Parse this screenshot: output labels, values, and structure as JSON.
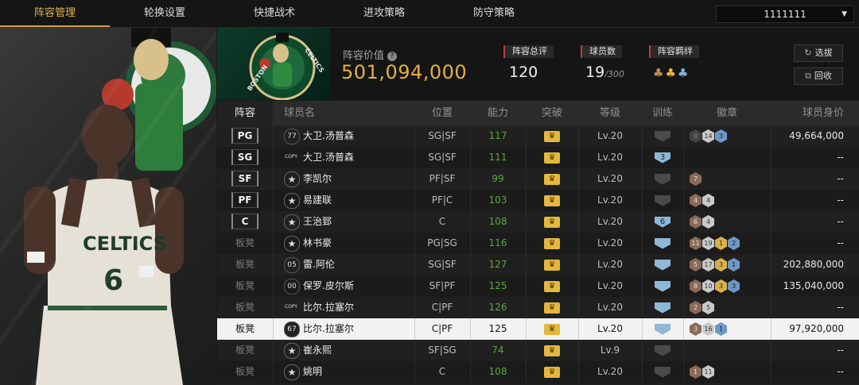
{
  "nav": {
    "tabs": [
      "阵容管理",
      "轮换设置",
      "快捷战术",
      "进攻策略",
      "防守策略"
    ],
    "active_index": 0,
    "account": "1111111"
  },
  "header": {
    "team_value_label": "阵容价值",
    "team_value": "501,094,000",
    "rating_label": "阵容总评",
    "rating": "120",
    "player_count_label": "球员数",
    "player_count": "19",
    "player_capacity": "/300",
    "bond_label": "阵容羁绊",
    "btn_select": "选拔",
    "btn_recycle": "回收"
  },
  "table": {
    "headers": [
      "阵容",
      "球员名",
      "位置",
      "能力",
      "突破",
      "等级",
      "训练",
      "徽章",
      "球员身价"
    ],
    "rows": [
      {
        "slot": "PG",
        "starter": true,
        "num": "77",
        "name": "大卫.汤普森",
        "pos": "SG|SF",
        "ability": "117",
        "level": "Lv.20",
        "train": "",
        "train_on": false,
        "badges": [
          [
            "dark",
            "0"
          ],
          [
            "silver",
            "14"
          ],
          [
            "blue",
            "3"
          ]
        ],
        "price": "49,664,000"
      },
      {
        "slot": "SG",
        "starter": true,
        "num": "COPY",
        "name": "大卫.汤普森",
        "pos": "SG|SF",
        "ability": "111",
        "level": "Lv.20",
        "train": "3",
        "train_on": true,
        "badges": [],
        "price": "--"
      },
      {
        "slot": "SF",
        "starter": true,
        "num": "★",
        "name": "李凯尔",
        "pos": "PF|SF",
        "ability": "99",
        "level": "Lv.20",
        "train": "",
        "train_on": false,
        "badges": [
          [
            "bronze",
            "7"
          ]
        ],
        "price": "--"
      },
      {
        "slot": "PF",
        "starter": true,
        "num": "★",
        "name": "易建联",
        "pos": "PF|C",
        "ability": "103",
        "level": "Lv.20",
        "train": "",
        "train_on": false,
        "badges": [
          [
            "bronze",
            "4"
          ],
          [
            "silver",
            "4"
          ]
        ],
        "price": "--"
      },
      {
        "slot": "C",
        "starter": true,
        "num": "★",
        "name": "王治郅",
        "pos": "C",
        "ability": "108",
        "level": "Lv.20",
        "train": "6",
        "train_on": true,
        "badges": [
          [
            "bronze",
            "6"
          ],
          [
            "silver",
            "4"
          ]
        ],
        "price": "--"
      },
      {
        "slot": "板凳",
        "starter": false,
        "num": "★",
        "name": "林书豪",
        "pos": "PG|SG",
        "ability": "116",
        "level": "Lv.20",
        "train": "",
        "train_on": true,
        "badges": [
          [
            "bronze",
            "11"
          ],
          [
            "silver",
            "19"
          ],
          [
            "gold",
            "1"
          ],
          [
            "blue",
            "2"
          ]
        ],
        "price": "--"
      },
      {
        "slot": "板凳",
        "starter": false,
        "num": "05",
        "name": "雷.阿伦",
        "pos": "SG|SF",
        "ability": "127",
        "level": "Lv.20",
        "train": "",
        "train_on": true,
        "badges": [
          [
            "bronze",
            "5"
          ],
          [
            "silver",
            "17"
          ],
          [
            "gold",
            "3"
          ],
          [
            "blue",
            "1"
          ]
        ],
        "price": "202,880,000"
      },
      {
        "slot": "板凳",
        "starter": false,
        "num": "00",
        "name": "保罗.皮尔斯",
        "pos": "SF|PF",
        "ability": "125",
        "level": "Lv.20",
        "train": "",
        "train_on": true,
        "badges": [
          [
            "bronze",
            "8"
          ],
          [
            "silver",
            "10"
          ],
          [
            "gold",
            "3"
          ],
          [
            "blue",
            "3"
          ]
        ],
        "price": "135,040,000"
      },
      {
        "slot": "板凳",
        "starter": false,
        "num": "COPY",
        "name": "比尔.拉塞尔",
        "pos": "C|PF",
        "ability": "126",
        "level": "Lv.20",
        "train": "",
        "train_on": true,
        "badges": [
          [
            "bronze",
            "2"
          ],
          [
            "silver",
            "5"
          ]
        ],
        "price": "--"
      },
      {
        "slot": "板凳",
        "starter": false,
        "num": "67",
        "name": "比尔.拉塞尔",
        "pos": "C|PF",
        "ability": "125",
        "level": "Lv.20",
        "train": "",
        "train_on": true,
        "badges": [
          [
            "bronze",
            "3"
          ],
          [
            "silver",
            "16"
          ],
          [
            "blue",
            "1"
          ]
        ],
        "price": "97,920,000",
        "highlight": true
      },
      {
        "slot": "板凳",
        "starter": false,
        "num": "★",
        "name": "崔永熙",
        "pos": "SF|SG",
        "ability": "74",
        "level": "Lv.9",
        "train": "",
        "train_on": false,
        "badges": [],
        "price": "--"
      },
      {
        "slot": "板凳",
        "starter": false,
        "num": "★",
        "name": "姚明",
        "pos": "C",
        "ability": "108",
        "level": "Lv.20",
        "train": "",
        "train_on": false,
        "badges": [
          [
            "bronze",
            "1"
          ],
          [
            "silver",
            "11"
          ]
        ],
        "price": "--"
      }
    ]
  },
  "colors": {
    "accent": "#e0b24a",
    "value": "#e6b040",
    "green": "#5aa63c",
    "celtics": "#0e3b28"
  }
}
